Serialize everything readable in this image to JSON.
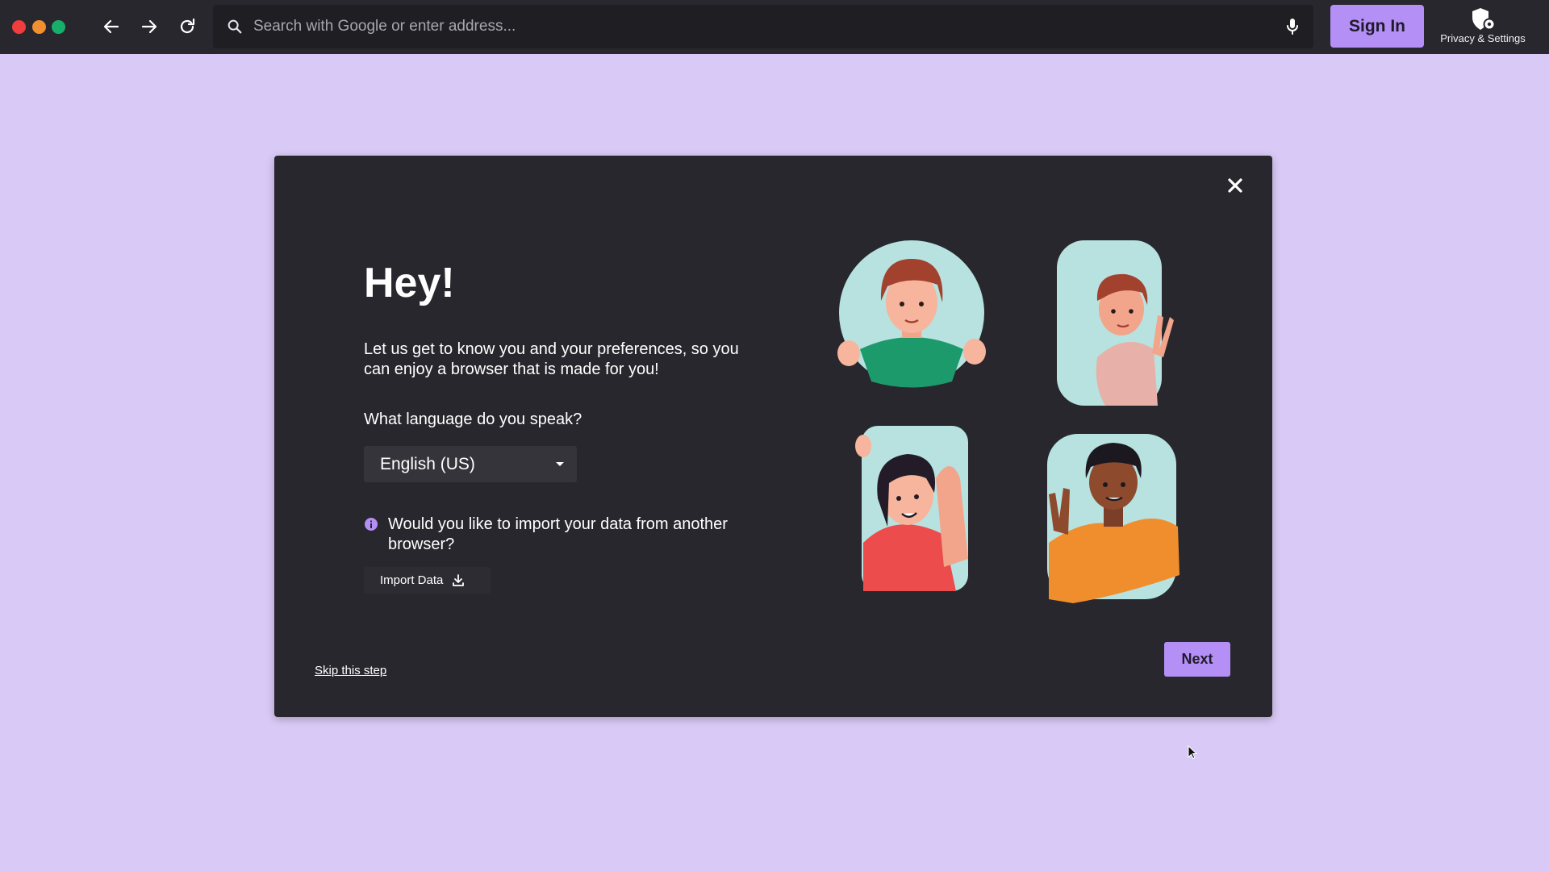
{
  "browser": {
    "address_placeholder": "Search with Google or enter address...",
    "sign_in_label": "Sign In",
    "privacy_label": "Privacy & Settings",
    "icons": [
      "back-icon",
      "forward-icon",
      "reload-icon",
      "search-icon",
      "mic-icon",
      "shield-gear-icon"
    ]
  },
  "welcome": {
    "title": "Hey!",
    "intro": "Let us get to know you and your preferences, so you can enjoy a browser that is made for you!",
    "language_question": "What language do you speak?",
    "language_selected": "English (US)",
    "import_question": "Would you like to import your data from another browser?",
    "import_button": "Import Data",
    "skip_link": "Skip this step",
    "next_button": "Next"
  },
  "colors": {
    "page_bg": "#d9c9f6",
    "topbar_bg": "#28272d",
    "modal_bg": "#28272d",
    "accent": "#b48ff5"
  }
}
